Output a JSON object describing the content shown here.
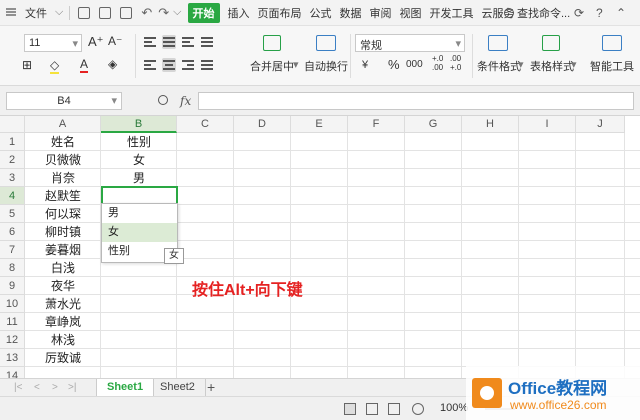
{
  "menubar": {
    "file": "文件",
    "tabs": [
      "开始",
      "插入",
      "页面布局",
      "公式",
      "数据",
      "审阅",
      "视图",
      "开发工具",
      "云服务"
    ],
    "search": "查找命令..."
  },
  "ribbon": {
    "font_size": "11",
    "number_format": "常规",
    "merge_center": "合并居中",
    "wrap_text": "自动换行",
    "cond_format": "条件格式",
    "table_style": "表格样式",
    "smart_tool": "智能工具",
    "percent": "%",
    "thousands": "000",
    "dec_inc": "+.0\n.00",
    "dec_dec": ".00\n+.0",
    "font_grow": "A⁺",
    "font_shrink": "A⁻",
    "yen": "¥"
  },
  "formula_bar": {
    "cell_ref": "B4",
    "fx": "fx",
    "value": ""
  },
  "columns": [
    "A",
    "B",
    "C",
    "D",
    "E",
    "F",
    "G",
    "H",
    "I",
    "J"
  ],
  "rows": [
    "1",
    "2",
    "3",
    "4",
    "5",
    "6",
    "7",
    "8",
    "9",
    "10",
    "11",
    "12",
    "13",
    "14"
  ],
  "cells": {
    "A": [
      "姓名",
      "贝微微",
      "肖奈",
      "赵默笙",
      "何以琛",
      "柳时镇",
      "姜暮烟",
      "白浅",
      "夜华",
      "萧水光",
      "章峥岚",
      "林浅",
      "厉致诚"
    ],
    "B": [
      "性别",
      "女",
      "男"
    ]
  },
  "dropdown": {
    "options": [
      "男",
      "女",
      "性别"
    ],
    "highlighted_index": 1,
    "tooltip": "女"
  },
  "annotation": "按住Alt+向下键",
  "sheets": [
    "Sheet1",
    "Sheet2"
  ],
  "active_sheet": "Sheet1",
  "status": {
    "zoom": "100%"
  },
  "logo": {
    "name": "Office教程网",
    "url": "www.office26.com"
  },
  "colors": {
    "accent": "#2aa843",
    "annotation": "#e52222",
    "logo_blue": "#1e6fc1",
    "logo_orange": "#f08a1c"
  }
}
